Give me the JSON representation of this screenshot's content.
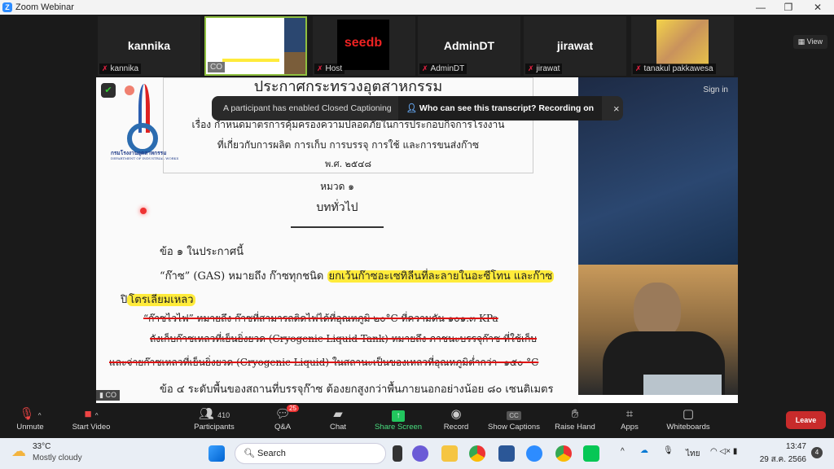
{
  "window": {
    "title": "Zoom Webinar"
  },
  "participants_strip": [
    {
      "big": "kannika",
      "name": "kannika",
      "muted": true
    },
    {
      "big": "",
      "name": "CO",
      "muted": false,
      "sharing": true
    },
    {
      "big": "seedb",
      "name": "Host",
      "muted": true
    },
    {
      "big": "AdminDT",
      "name": "AdminDT",
      "muted": true
    },
    {
      "big": "jirawat",
      "name": "jirawat",
      "muted": true
    },
    {
      "big": "",
      "name": "tanakul pakkawesa",
      "muted": true
    }
  ],
  "view_button": "View",
  "toast": {
    "message": "A participant has enabled Closed Captioning",
    "link": "Who can see this transcript? Recording on",
    "close": "×"
  },
  "shared": {
    "sign_in": "Sign in",
    "presenter_label": "CO",
    "logo_text": "กรมโรงงานอุตสาหกรรม",
    "logo_subtext": "DEPARTMENT OF INDUSTRIAL WORKS",
    "doc": {
      "heading": "ประกาศกระทรวงอุตสาหกรรม",
      "subject_1": "เรื่อง  กำหนดมาตรการคุ้มครองความปลอดภัยในการประกอบกิจการโรงงาน",
      "subject_2": "ที่เกี่ยวกับการผลิต การเก็บ การบรรจุ การใช้ และการขนส่งก๊าซ",
      "year": "พ.ศ. ๒๕๔๘",
      "chapter": "หมวด ๑",
      "chapter_title": "บททั่วไป",
      "clause1": "ข้อ  ๑  ในประกาศนี้",
      "gas_def_a": "“ก๊าซ” (GAS) หมายถึง ก๊าซทุกชนิด ",
      "gas_def_hl": "ยกเว้นก๊าซอะเซทิลีนที่ละลายในอะซีโทน และก๊าซ",
      "gas_def_b1": "ปิ",
      "gas_def_b2": "โตรเลียมเหลว",
      "struck1": "“ก๊าซไวไฟ” หมายถึง ก๊าซที่สามารถติดไฟได้ที่อุณหภูมิ ๒๐°C ที่ความดัน ๑๐๑.๓ KPa",
      "struck2": "ถังเก็บก๊าซเหลวที่เย็นยิ่งยวด (Cryogenic Liquid Tank) หมายถึง ภาชนะบรรจุก๊าซ ที่ใช้เก็บ",
      "struck3": "และจ่ายก๊าซเหลวที่เย็นยิ่งยวด (Cryogenic Liquid) ในสถานะเป็นของเหลวที่อุณหภูมิต่ำกว่า -๑๕๐ °C",
      "clause4": "ข้อ  ๔  ระดับพื้นของสถานที่บรรจุก๊าซ ต้องยกสูงกว่าพื้นภายนอกอย่างน้อย ๘๐ เซนติเมตร"
    }
  },
  "toolbar": {
    "unmute": "Unmute",
    "start_video": "Start Video",
    "participants": "Participants",
    "participants_count": "410",
    "qa": "Q&A",
    "qa_badge": "25",
    "chat": "Chat",
    "share_screen": "Share Screen",
    "record": "Record",
    "captions": "Show Captions",
    "cc": "CC",
    "raise_hand": "Raise Hand",
    "apps": "Apps",
    "whiteboards": "Whiteboards",
    "leave": "Leave"
  },
  "taskbar": {
    "temp": "33°C",
    "weather": "Mostly cloudy",
    "search": "Search",
    "lang": "ไทย",
    "time": "13:47",
    "date": "29 ส.ค. 2566",
    "notif": "4"
  },
  "colors": {
    "share_green": "#22c55e",
    "leave_red": "#c82b2b",
    "highlight": "#ffeb3b",
    "strike": "#dd1111"
  }
}
